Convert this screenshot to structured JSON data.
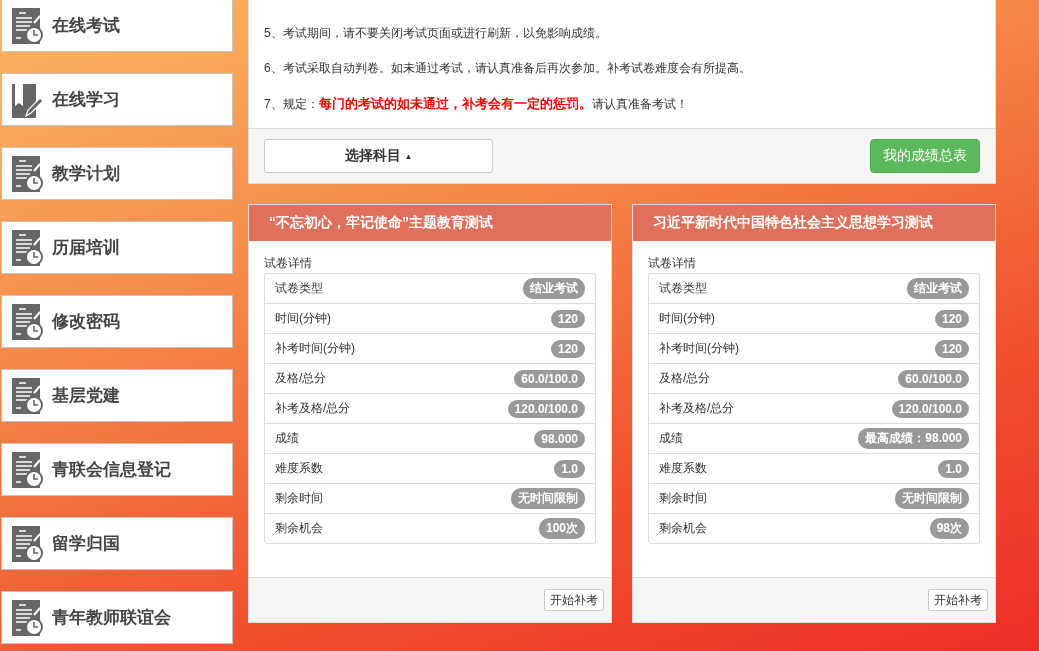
{
  "sidebar": {
    "items": [
      {
        "label": "在线考试",
        "kind": "document"
      },
      {
        "label": "在线学习",
        "kind": "book"
      },
      {
        "label": "教学计划",
        "kind": "document"
      },
      {
        "label": "历届培训",
        "kind": "document"
      },
      {
        "label": "修改密码",
        "kind": "document"
      },
      {
        "label": "基层党建",
        "kind": "document"
      },
      {
        "label": "青联会信息登记",
        "kind": "document"
      },
      {
        "label": "留学归国",
        "kind": "document"
      },
      {
        "label": "青年教师联谊会",
        "kind": "document"
      }
    ]
  },
  "notice": {
    "rules": [
      "5、考试期间，请不要关闭考试页面或进行刷新，以免影响成绩。",
      "6、考试采取自动判卷。如未通过考试，请认真准备后再次参加。补考试卷难度会有所提高。",
      "7、规定：**每门的考试的如未通过，补考会有一定的惩罚。**请认真准备考试！"
    ],
    "subject_button": "选择科目",
    "caret": "▲",
    "scores_button": "我的成绩总表"
  },
  "exams": [
    {
      "title": "“不忘初心，牢记使命”主题教育测试",
      "details_label": "试卷详情",
      "rows": [
        {
          "label": "试卷类型",
          "value": "结业考试"
        },
        {
          "label": "时间(分钟)",
          "value": "120"
        },
        {
          "label": "补考时间(分钟)",
          "value": "120"
        },
        {
          "label": "及格/总分",
          "value": "60.0/100.0"
        },
        {
          "label": "补考及格/总分",
          "value": "120.0/100.0"
        },
        {
          "label": "成绩",
          "value": "98.000"
        },
        {
          "label": "难度系数",
          "value": "1.0"
        },
        {
          "label": "剩余时间",
          "value": "无时间限制"
        },
        {
          "label": "剩余机会",
          "value": "100次"
        }
      ],
      "action": "开始补考"
    },
    {
      "title": "习近平新时代中国特色社会主义思想学习测试",
      "details_label": "试卷详情",
      "rows": [
        {
          "label": "试卷类型",
          "value": "结业考试"
        },
        {
          "label": "时间(分钟)",
          "value": "120"
        },
        {
          "label": "补考时间(分钟)",
          "value": "120"
        },
        {
          "label": "及格/总分",
          "value": "60.0/100.0"
        },
        {
          "label": "补考及格/总分",
          "value": "120.0/100.0"
        },
        {
          "label": "成绩",
          "value": "最高成绩：98.000"
        },
        {
          "label": "难度系数",
          "value": "1.0"
        },
        {
          "label": "剩余时间",
          "value": "无时间限制"
        },
        {
          "label": "剩余机会",
          "value": "98次"
        }
      ],
      "action": "开始补考"
    }
  ]
}
